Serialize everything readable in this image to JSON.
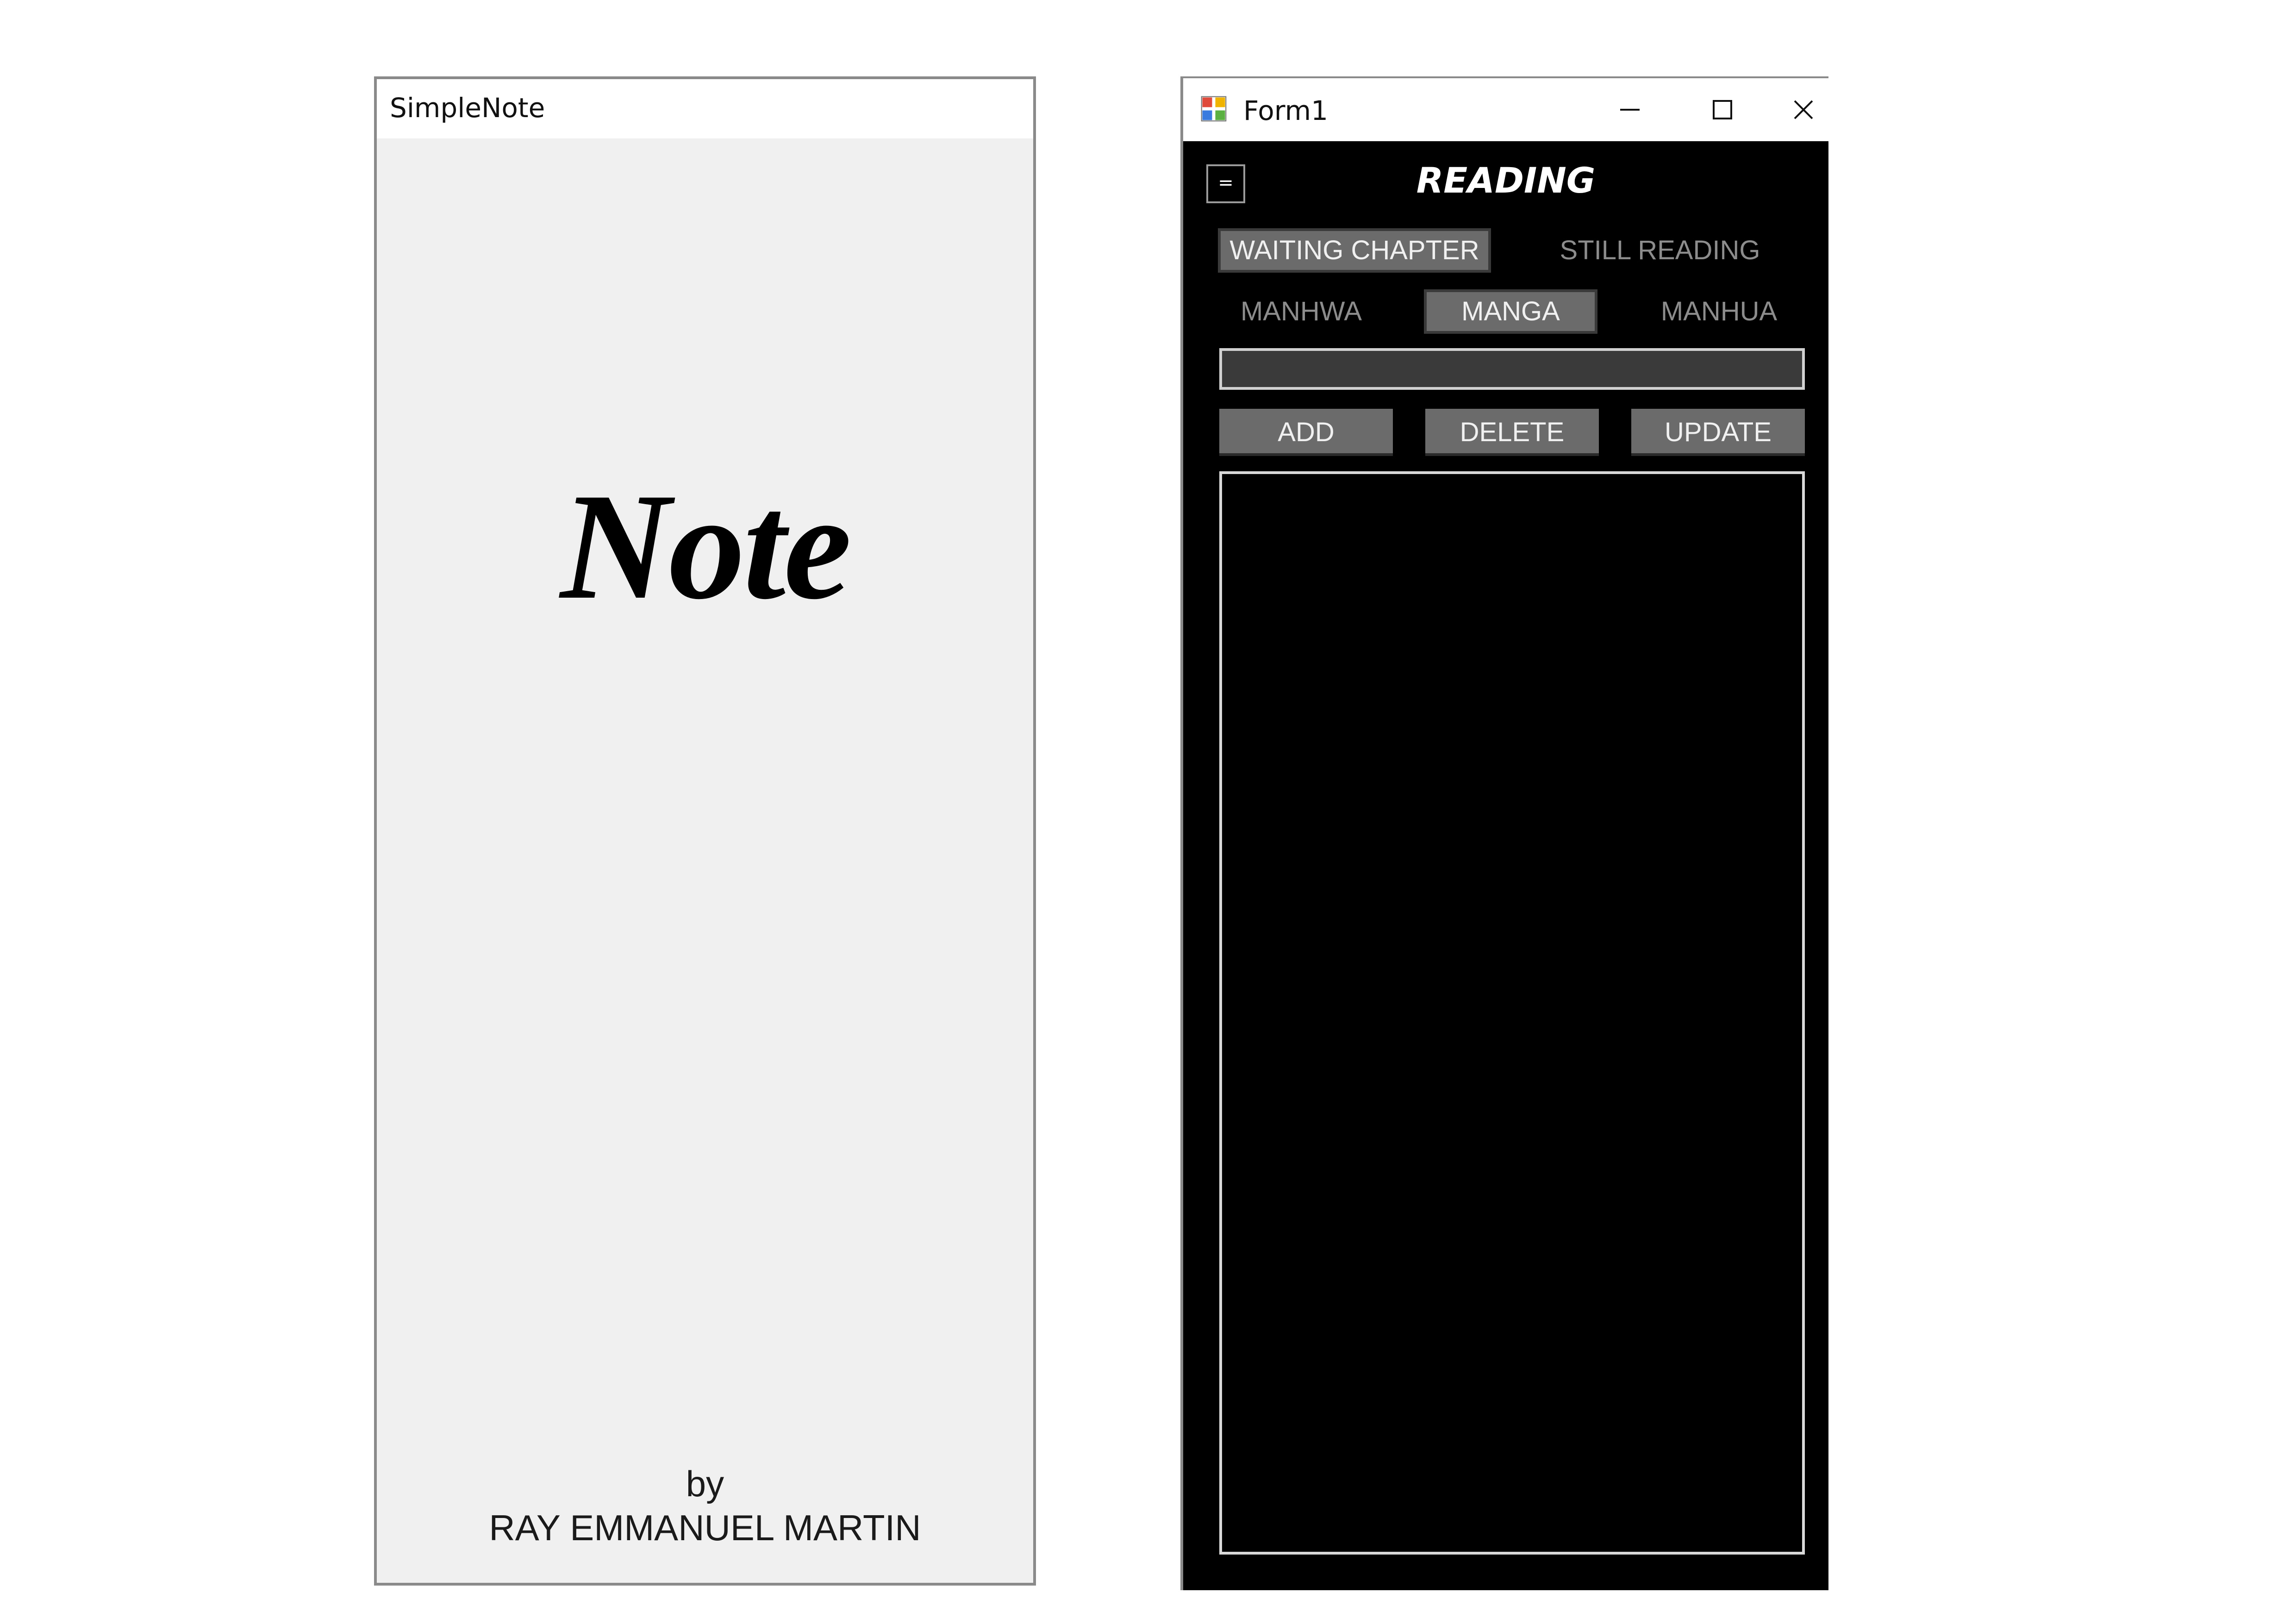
{
  "splash_window": {
    "title": "SimpleNote",
    "logo_text": "Note",
    "byline": "by",
    "author": "RAY EMMANUEL MARTIN"
  },
  "form_window": {
    "title": "Form1",
    "controls": {
      "minimize_icon": "minimize-icon",
      "maximize_icon": "maximize-icon",
      "close_icon": "close-icon"
    },
    "menu_toggle_label": "=",
    "section_title": "READING",
    "status_tabs": [
      {
        "label": "WAITING CHAPTER",
        "active": true
      },
      {
        "label": "STILL READING",
        "active": false
      }
    ],
    "type_tabs": [
      {
        "label": "MANHWA",
        "active": false
      },
      {
        "label": "MANGA",
        "active": true
      },
      {
        "label": "MANHUA",
        "active": false
      }
    ],
    "entry_input": {
      "value": "",
      "placeholder": ""
    },
    "actions": {
      "add": "ADD",
      "delete": "DELETE",
      "update": "UPDATE"
    },
    "list_items": []
  },
  "colors": {
    "form_background": "#000000",
    "button_background": "#6b6b6b",
    "splash_background": "#f0f0f0",
    "inactive_tab_text": "#8c8c8c"
  }
}
